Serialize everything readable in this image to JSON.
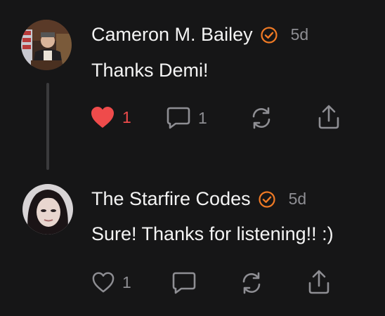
{
  "comments": [
    {
      "author": "Cameron M. Bailey",
      "verified_icon": "verified-check-icon",
      "time": "5d",
      "text": "Thanks Demi!",
      "likes": "1",
      "liked": true,
      "replies": "1"
    },
    {
      "author": "The Starfire Codes",
      "verified_icon": "verified-check-icon",
      "time": "5d",
      "text": "Sure! Thanks for listening!! :)",
      "likes": "1",
      "liked": false
    }
  ],
  "colors": {
    "background": "#161617",
    "like_active": "#ef4b4b",
    "verified": "#f07a25",
    "muted": "#8e8e93"
  }
}
